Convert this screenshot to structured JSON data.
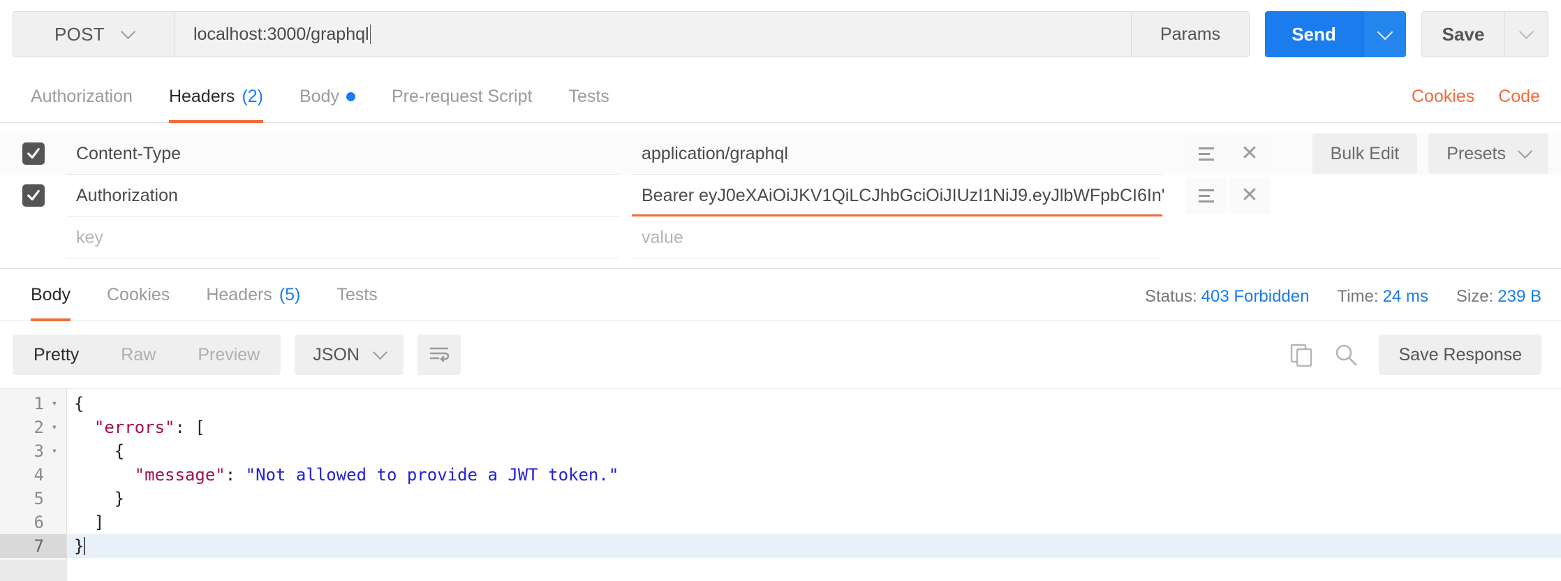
{
  "request": {
    "method": "POST",
    "url": "localhost:3000/graphql",
    "params_label": "Params",
    "send_label": "Send",
    "save_label": "Save"
  },
  "request_tabs": [
    {
      "label": "Authorization",
      "count": "",
      "active": false,
      "dot": false
    },
    {
      "label": "Headers",
      "count": "(2)",
      "active": true,
      "dot": false
    },
    {
      "label": "Body",
      "count": "",
      "active": false,
      "dot": true
    },
    {
      "label": "Pre-request Script",
      "count": "",
      "active": false,
      "dot": false
    },
    {
      "label": "Tests",
      "count": "",
      "active": false,
      "dot": false
    }
  ],
  "tabs_right": {
    "cookies": "Cookies",
    "code": "Code"
  },
  "headers_table": {
    "bulk_edit_label": "Bulk Edit",
    "presets_label": "Presets",
    "key_placeholder": "key",
    "value_placeholder": "value",
    "rows": [
      {
        "checked": true,
        "key": "Content-Type",
        "value": "application/graphql",
        "focused": false
      },
      {
        "checked": true,
        "key": "Authorization",
        "value": "Bearer eyJ0eXAiOiJKV1QiLCJhbGciOiJIUzI1NiJ9.eyJlbWFpbCI6In'",
        "focused": true
      }
    ]
  },
  "response_tabs": [
    {
      "label": "Body",
      "count": "",
      "active": true
    },
    {
      "label": "Cookies",
      "count": "",
      "active": false
    },
    {
      "label": "Headers",
      "count": "(5)",
      "active": false
    },
    {
      "label": "Tests",
      "count": "",
      "active": false
    }
  ],
  "response_status": {
    "status_label": "Status:",
    "status_value": "403 Forbidden",
    "time_label": "Time:",
    "time_value": "24 ms",
    "size_label": "Size:",
    "size_value": "239 B"
  },
  "response_toolbar": {
    "pretty": "Pretty",
    "raw": "Raw",
    "preview": "Preview",
    "format": "JSON",
    "save_response": "Save Response"
  },
  "code": {
    "lines": [
      {
        "num": "1",
        "fold": true,
        "current": false,
        "parts": [
          {
            "t": "{",
            "c": "p"
          }
        ]
      },
      {
        "num": "2",
        "fold": true,
        "current": false,
        "parts": [
          {
            "t": "  ",
            "c": "p"
          },
          {
            "t": "\"errors\"",
            "c": "k"
          },
          {
            "t": ": [",
            "c": "p"
          }
        ]
      },
      {
        "num": "3",
        "fold": true,
        "current": false,
        "parts": [
          {
            "t": "    {",
            "c": "p"
          }
        ]
      },
      {
        "num": "4",
        "fold": false,
        "current": false,
        "parts": [
          {
            "t": "      ",
            "c": "p"
          },
          {
            "t": "\"message\"",
            "c": "k"
          },
          {
            "t": ": ",
            "c": "p"
          },
          {
            "t": "\"Not allowed to provide a JWT token.\"",
            "c": "s"
          }
        ]
      },
      {
        "num": "5",
        "fold": false,
        "current": false,
        "parts": [
          {
            "t": "    }",
            "c": "p"
          }
        ]
      },
      {
        "num": "6",
        "fold": false,
        "current": false,
        "parts": [
          {
            "t": "  ]",
            "c": "p"
          }
        ]
      },
      {
        "num": "7",
        "fold": false,
        "current": true,
        "parts": [
          {
            "t": "}",
            "c": "p"
          }
        ]
      }
    ]
  },
  "colors": {
    "accent_orange": "#f26b3a",
    "accent_blue": "#1a7ced",
    "json_key": "#a1104f",
    "json_string": "#2222d6"
  }
}
